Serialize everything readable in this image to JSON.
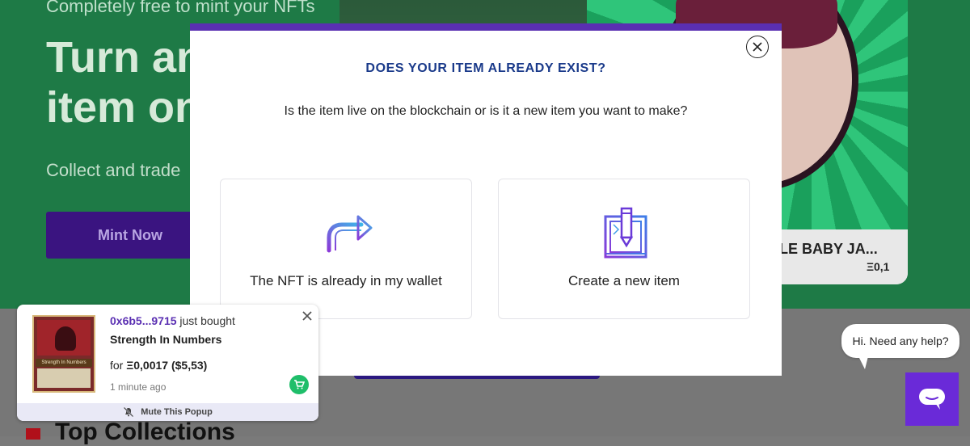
{
  "background": {
    "hero_subtitle": "Completely free to mint your NFTs",
    "hero_title_line1": "Turn an",
    "hero_title_line2": "item on",
    "hero_collect": "Collect and trade",
    "mint_button": "Mint Now",
    "featured_card": {
      "title": "LE BABY JA...",
      "price": "Ξ0,1"
    },
    "section_heading": "Top Collections"
  },
  "modal": {
    "title": "DOES YOUR ITEM ALREADY EXIST?",
    "description": "Is the item live on the blockchain or is it a new item you want to make?",
    "options": [
      {
        "label": "The NFT is already in my wallet",
        "icon": "redirect-arrow-icon"
      },
      {
        "label": "Create a new item",
        "icon": "create-pencil-icon"
      }
    ],
    "close_icon": "close-circle-icon"
  },
  "purchase_popup": {
    "buyer": "0x6b5...9715",
    "action": " just bought",
    "item_name": "Strength In Numbers",
    "price_prefix": "for ",
    "price": "Ξ0,0017 ($5,53)",
    "time": "1 minute ago",
    "mute_label": "Mute This Popup",
    "thumb_banner": "Strength In Numbers"
  },
  "chat": {
    "bubble": "Hi. Need any help?"
  },
  "colors": {
    "modal_accent": "#5a2fb2",
    "title_blue": "#1a3a8a",
    "cart_green": "#1fbe6a",
    "chat_purple": "#6a2ad8"
  }
}
